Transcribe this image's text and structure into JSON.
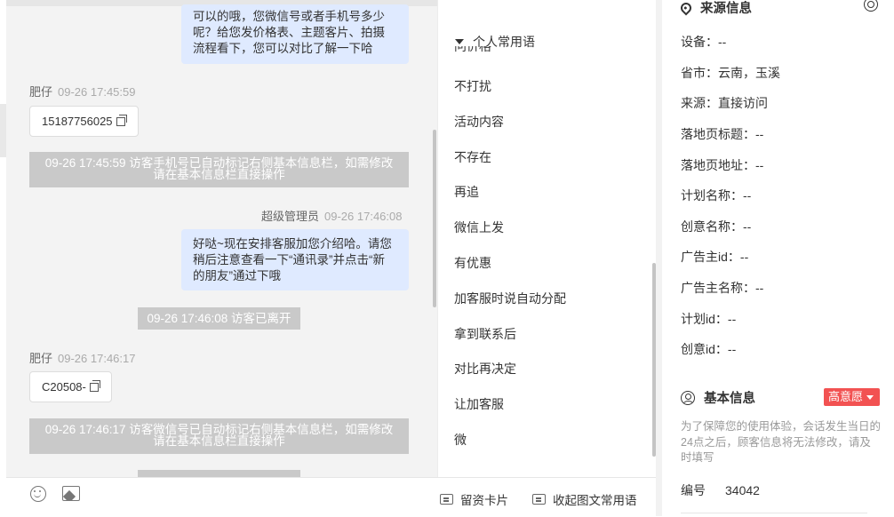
{
  "chat": {
    "bubble_1_lines": [
      "可以的哦，您微信号或者手机号多少",
      "呢？给您发价格表、主题客片、拍摄",
      "流程看下，您可以对比了解一下哈"
    ],
    "msg_1": {
      "sender": "肥仔",
      "time": "09-26 17:45:59",
      "content": "15187756025"
    },
    "sys_1_lines": [
      "09-26 17:45:59 访客手机号已自动标记右侧基本信息栏，如需修改",
      "请在基本信息栏直接操作"
    ],
    "msg_2": {
      "sender": "超级管理员",
      "time": "09-26 17:46:08",
      "lines": [
        "好哒~现在安排客服加您介绍哈。请您",
        "稍后注意查看一下“通讯录”并点击“新",
        "的朋友”通过下哦"
      ]
    },
    "sys_2": "09-26 17:46:08 访客已离开",
    "msg_3": {
      "sender": "肥仔",
      "time": "09-26 17:46:17",
      "content": "C20508-"
    },
    "sys_3_lines": [
      "09-26 17:46:17 访客微信号已自动标记右侧基本信息栏，如需修改",
      "请在基本信息栏直接操作"
    ]
  },
  "toolbar": {
    "emoji": "emoji-icon",
    "image": "image-icon",
    "card_label": "留资卡片",
    "collapse_label": "收起图文常用语"
  },
  "phrases": {
    "header": "个人常用语",
    "partial": "问价格",
    "items": [
      "不打扰",
      "活动内容",
      "不存在",
      "再追",
      "微信上发",
      "有优惠",
      "加客服时说自动分配",
      "拿到联系后",
      "对比再决定",
      "让加客服",
      "微"
    ]
  },
  "source_info": {
    "title": "来源信息",
    "rows": [
      {
        "label": "设备：",
        "value": "--"
      },
      {
        "label": "省市：",
        "value": "云南，玉溪"
      },
      {
        "label": "来源：",
        "value": "直接访问"
      },
      {
        "label": "落地页标题：",
        "value": "--"
      },
      {
        "label": "落地页地址：",
        "value": "--"
      },
      {
        "label": "计划名称：",
        "value": "--"
      },
      {
        "label": "创意名称：",
        "value": "--"
      },
      {
        "label": "广告主id：",
        "value": "--"
      },
      {
        "label": "广告主名称：",
        "value": "--"
      },
      {
        "label": "计划id：",
        "value": "--"
      },
      {
        "label": "创意id：",
        "value": "--"
      }
    ]
  },
  "basic_info": {
    "title": "基本信息",
    "intent_badge": "高意愿",
    "notice": "为了保障您的使用体验，会话发生当日的24点之后，顾客信息将无法修改，请及时填写",
    "number_label": "编号",
    "number_value": "34042"
  },
  "colors": {
    "bubble_out": "#dfeaff",
    "system_msg": "#c9c9c9",
    "badge": "#f25252"
  }
}
